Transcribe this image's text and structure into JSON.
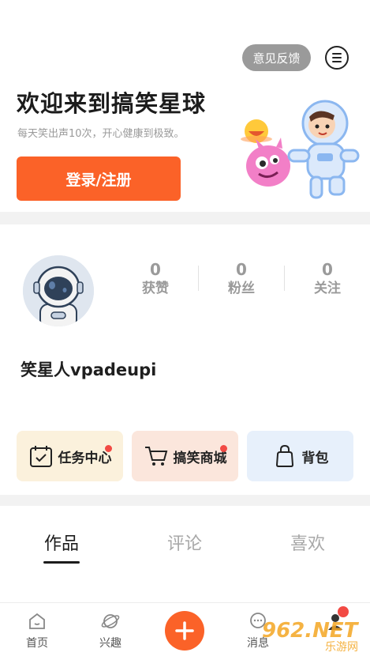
{
  "header": {
    "feedback_label": "意见反馈",
    "welcome_title": "欢迎来到搞笑星球",
    "welcome_subtitle": "每天笑出声10次，开心健康到极致。",
    "login_label": "登录/注册"
  },
  "profile": {
    "username": "笑星人vpadeupi",
    "stats": [
      {
        "value": "0",
        "label": "获赞"
      },
      {
        "value": "0",
        "label": "粉丝"
      },
      {
        "value": "0",
        "label": "关注"
      }
    ]
  },
  "quick_actions": [
    {
      "label": "任务中心",
      "icon": "calendar-check-icon",
      "bg": "#fbf1dc",
      "badge": true
    },
    {
      "label": "搞笑商城",
      "icon": "cart-icon",
      "bg": "#fbe6dc",
      "badge": true
    },
    {
      "label": "背包",
      "icon": "backpack-icon",
      "bg": "#e7f0fb",
      "badge": false
    }
  ],
  "content_tabs": [
    {
      "label": "作品",
      "active": true
    },
    {
      "label": "评论",
      "active": false
    },
    {
      "label": "喜欢",
      "active": false
    }
  ],
  "bottom_nav": {
    "home": "首页",
    "interest": "兴趣",
    "messages": "消息"
  },
  "watermark": {
    "brand": "962.NET",
    "sub": "乐游网"
  },
  "colors": {
    "accent": "#fb6228",
    "badge": "#f24a44"
  }
}
